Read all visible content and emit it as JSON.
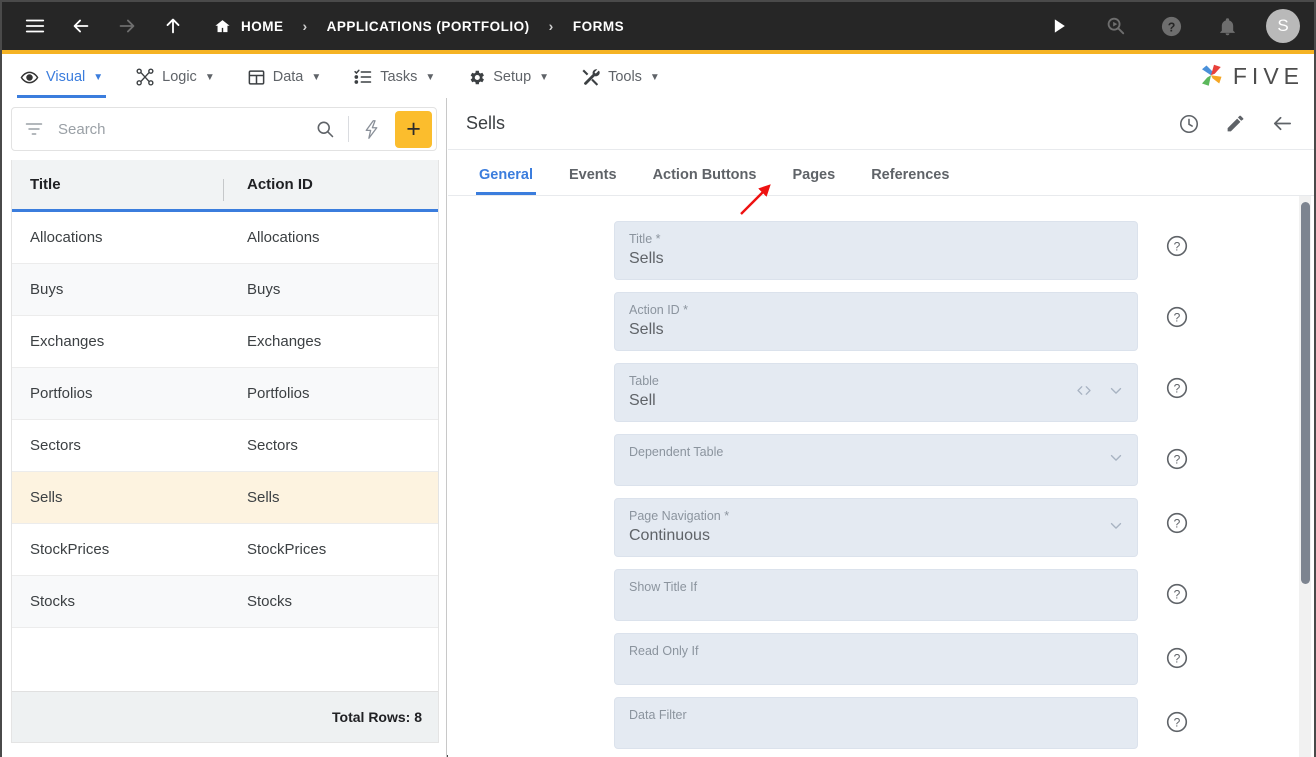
{
  "topbar": {
    "icons": {
      "menu": "hamburger-menu-icon",
      "back": "back-arrow-icon",
      "forward": "forward-arrow-icon",
      "up": "up-arrow-icon",
      "home": "home-icon",
      "run": "run-play-icon",
      "search_run": "search-run-icon",
      "help": "help-circle-icon",
      "notifications": "bell-icon"
    },
    "breadcrumb": [
      {
        "label": "HOME"
      },
      {
        "label": "APPLICATIONS (PORTFOLIO)"
      },
      {
        "label": "FORMS"
      }
    ],
    "separator": "›",
    "avatar_initial": "S",
    "background": "#262626"
  },
  "menubar": {
    "accent_top": "#f5b324",
    "active_color": "#3b7ddd",
    "caret": "▼",
    "items": [
      {
        "label": "Visual",
        "icon": "eye-icon",
        "active": true
      },
      {
        "label": "Logic",
        "icon": "logic-nodes-icon",
        "active": false
      },
      {
        "label": "Data",
        "icon": "table-grid-icon",
        "active": false
      },
      {
        "label": "Tasks",
        "icon": "checklist-icon",
        "active": false
      },
      {
        "label": "Setup",
        "icon": "gear-icon",
        "active": false
      },
      {
        "label": "Tools",
        "icon": "tools-icon",
        "active": false
      }
    ],
    "logo_text": "FIVE"
  },
  "sidebar": {
    "search": {
      "placeholder": "Search",
      "value": "",
      "filter_icon": "filter-icon",
      "search_icon": "search-icon",
      "flash_icon": "flash-lightning-icon",
      "add_label": "+"
    },
    "table": {
      "columns": [
        "Title",
        "Action ID"
      ],
      "rows": [
        {
          "title": "Allocations",
          "action_id": "Allocations"
        },
        {
          "title": "Buys",
          "action_id": "Buys"
        },
        {
          "title": "Exchanges",
          "action_id": "Exchanges"
        },
        {
          "title": "Portfolios",
          "action_id": "Portfolios"
        },
        {
          "title": "Sectors",
          "action_id": "Sectors"
        },
        {
          "title": "Sells",
          "action_id": "Sells"
        },
        {
          "title": "StockPrices",
          "action_id": "StockPrices"
        },
        {
          "title": "Stocks",
          "action_id": "Stocks"
        }
      ],
      "selected_index": 5,
      "footer": "Total Rows: 8",
      "header_underline_color": "#3b7ddd",
      "selected_row_color": "#fdf3e0"
    }
  },
  "detail": {
    "title": "Sells",
    "actions": [
      {
        "icon": "history-clock-icon",
        "name": "history-button"
      },
      {
        "icon": "pencil-edit-icon",
        "name": "edit-button"
      },
      {
        "icon": "back-arrow-icon",
        "name": "close-back-button"
      }
    ],
    "tabs": [
      {
        "label": "General",
        "active": true
      },
      {
        "label": "Events",
        "active": false
      },
      {
        "label": "Action Buttons",
        "active": false
      },
      {
        "label": "Pages",
        "active": false
      },
      {
        "label": "References",
        "active": false
      }
    ],
    "fields": [
      {
        "label": "Title *",
        "value": "Sells",
        "adornments": [],
        "tall": false
      },
      {
        "label": "Action ID *",
        "value": "Sells",
        "adornments": [],
        "tall": false
      },
      {
        "label": "Table",
        "value": "Sell",
        "adornments": [
          "code-brackets-icon",
          "chevron-down-icon"
        ],
        "tall": false
      },
      {
        "label": "Dependent Table",
        "value": "",
        "adornments": [
          "chevron-down-icon"
        ],
        "tall": true
      },
      {
        "label": "Page Navigation *",
        "value": "Continuous",
        "adornments": [
          "chevron-down-icon"
        ],
        "tall": false
      },
      {
        "label": "Show Title If",
        "value": "",
        "adornments": [],
        "tall": true
      },
      {
        "label": "Read Only If",
        "value": "",
        "adornments": [],
        "tall": true
      },
      {
        "label": "Data Filter",
        "value": "",
        "adornments": [],
        "tall": true
      }
    ],
    "help_icon": "help-circle-icon",
    "field_background": "#e4eaf2"
  },
  "annotation": {
    "type": "red-arrow",
    "points_to": "Pages",
    "color": "#ee1111"
  }
}
